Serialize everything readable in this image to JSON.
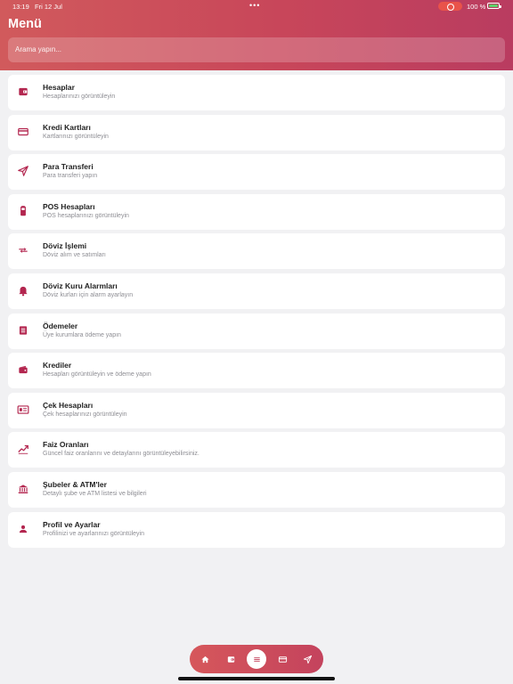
{
  "status_bar": {
    "time": "13:19",
    "date": "Fri 12 Jul",
    "battery": "100 %"
  },
  "header": {
    "title": "Menü",
    "search_placeholder": "Arama yapın..."
  },
  "menu_items": [
    {
      "title": "Hesaplar",
      "subtitle": "Hesaplarınızı görüntüleyin",
      "icon": "wallet-icon"
    },
    {
      "title": "Kredi Kartları",
      "subtitle": "Kartlarınızı görüntüleyin",
      "icon": "credit-card-icon"
    },
    {
      "title": "Para Transferi",
      "subtitle": "Para transferi yapın",
      "icon": "send-icon"
    },
    {
      "title": "POS Hesapları",
      "subtitle": "POS hesaplarınızı görüntüleyin",
      "icon": "pos-terminal-icon"
    },
    {
      "title": "Döviz İşlemi",
      "subtitle": "Döviz alım ve satımları",
      "icon": "exchange-icon"
    },
    {
      "title": "Döviz Kuru Alarmları",
      "subtitle": "Döviz kurları için alarm ayarlayın",
      "icon": "bell-icon"
    },
    {
      "title": "Ödemeler",
      "subtitle": "Üye kurumlara ödeme yapın",
      "icon": "receipt-icon"
    },
    {
      "title": "Krediler",
      "subtitle": "Hesapları görüntüleyin ve ödeme yapın",
      "icon": "loan-wallet-icon"
    },
    {
      "title": "Çek Hesapları",
      "subtitle": "Çek hesaplarınızı görüntüleyin",
      "icon": "cheque-icon"
    },
    {
      "title": "Faiz Oranları",
      "subtitle": "Güncel faiz oranlarını ve detaylarını görüntüleyebilirsiniz.",
      "icon": "trending-up-icon"
    },
    {
      "title": "Şubeler & ATM'ler",
      "subtitle": "Detaylı şube ve ATM listesi ve bilgileri",
      "icon": "bank-icon"
    },
    {
      "title": "Profil ve Ayarlar",
      "subtitle": "Profilinizi ve ayarlarınızı görüntüleyin",
      "icon": "person-icon"
    }
  ],
  "tab_bar": {
    "active": "menu",
    "tabs": [
      "home-icon",
      "wallet-icon",
      "menu-icon",
      "credit-card-icon",
      "send-icon"
    ]
  },
  "colors": {
    "accent": "#b3264f",
    "header_start": "#d15a5c",
    "header_end": "#b93c60",
    "background": "#f1f1f3"
  }
}
